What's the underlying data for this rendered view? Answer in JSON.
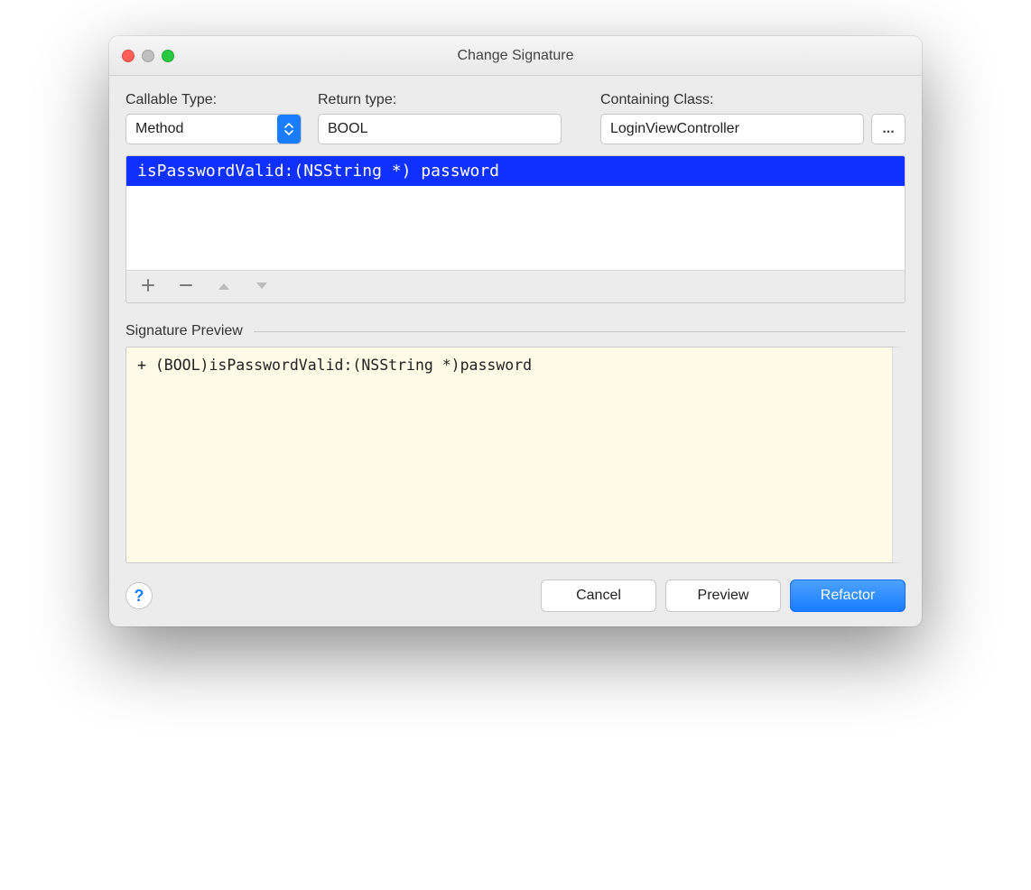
{
  "window": {
    "title": "Change Signature"
  },
  "fields": {
    "callable_type_label": "Callable Type:",
    "callable_type_value": "Method",
    "return_type_label": "Return type:",
    "return_type_value": "BOOL",
    "containing_class_label": "Containing Class:",
    "containing_class_value": "LoginViewController",
    "ellipsis": "..."
  },
  "parameters": {
    "rows": [
      "isPasswordValid:(NSString *) password"
    ]
  },
  "preview": {
    "heading": "Signature Preview",
    "code": "+ (BOOL)isPasswordValid:(NSString *)password"
  },
  "buttons": {
    "help": "?",
    "cancel": "Cancel",
    "preview": "Preview",
    "refactor": "Refactor"
  },
  "icons": {
    "add": "add-icon",
    "remove": "remove-icon",
    "up": "move-up-icon",
    "down": "move-down-icon"
  }
}
